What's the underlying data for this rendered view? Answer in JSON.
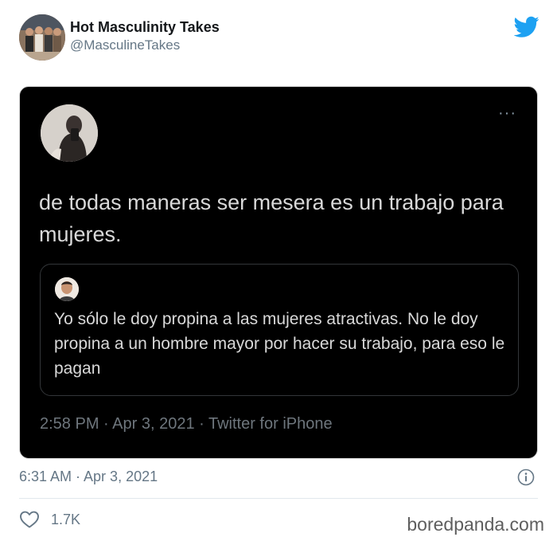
{
  "embed": {
    "author_name": "Hot Masculinity Takes",
    "author_handle": "@MasculineTakes",
    "timestamp": "6:31 AM · Apr 3, 2021",
    "like_count": "1.7K"
  },
  "screenshot": {
    "more_label": "···",
    "text": "de todas maneras ser mesera es un trabajo para mujeres.",
    "quoted_text": "Yo sólo le doy propina a las mujeres atractivas. No le doy propina a un hombre mayor por hacer su trabajo, para eso le pagan",
    "timestamp": "2:58 PM · Apr 3, 2021 · Twitter for iPhone"
  },
  "watermark": "boredpanda.com",
  "icons": {
    "brand": "twitter-bird-icon",
    "info": "info-icon",
    "like": "heart-icon",
    "more": "more-options-icon"
  },
  "colors": {
    "twitter_blue": "#1da1f2",
    "secondary_text": "#657786",
    "screenshot_bg": "#000000",
    "screenshot_text": "#d9d9d9"
  }
}
